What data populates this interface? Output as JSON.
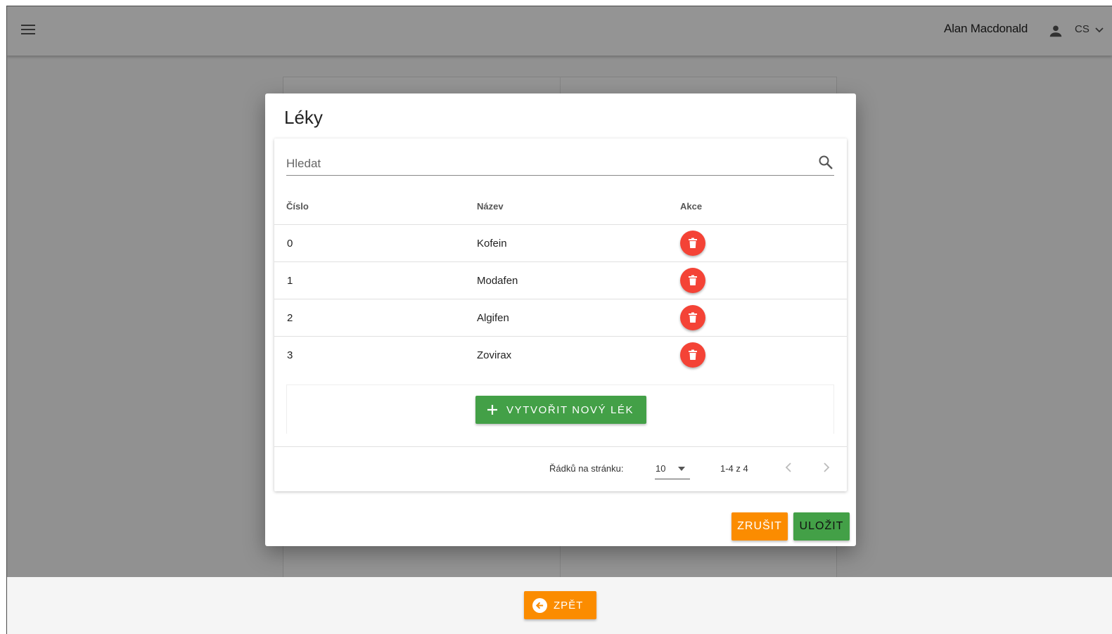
{
  "header": {
    "user_name": "Alan Macdonald",
    "language": "CS",
    "menu_icon": "hamburger-menu-icon",
    "user_icon": "person-icon"
  },
  "background": {
    "back_label": "ZPĚT"
  },
  "dialog": {
    "title": "Léky",
    "search": {
      "placeholder": "Hledat",
      "value": ""
    },
    "columns": {
      "number": "Číslo",
      "name": "Název",
      "actions": "Akce"
    },
    "rows": [
      {
        "number": "0",
        "name": "Kofein"
      },
      {
        "number": "1",
        "name": "Modafen"
      },
      {
        "number": "2",
        "name": "Algifen"
      },
      {
        "number": "3",
        "name": "Zovirax"
      }
    ],
    "create_label": "VYTVOŘIT NOVÝ LÉK",
    "pagination": {
      "rows_per_page_label": "Řádků na stránku:",
      "rows_per_page": "10",
      "range": "1-4 z 4"
    },
    "cancel_label": "ZRUŠIT",
    "save_label": "ULOŽIT"
  },
  "colors": {
    "orange": "#fb8c00",
    "green": "#43a047",
    "red": "#f44336"
  }
}
